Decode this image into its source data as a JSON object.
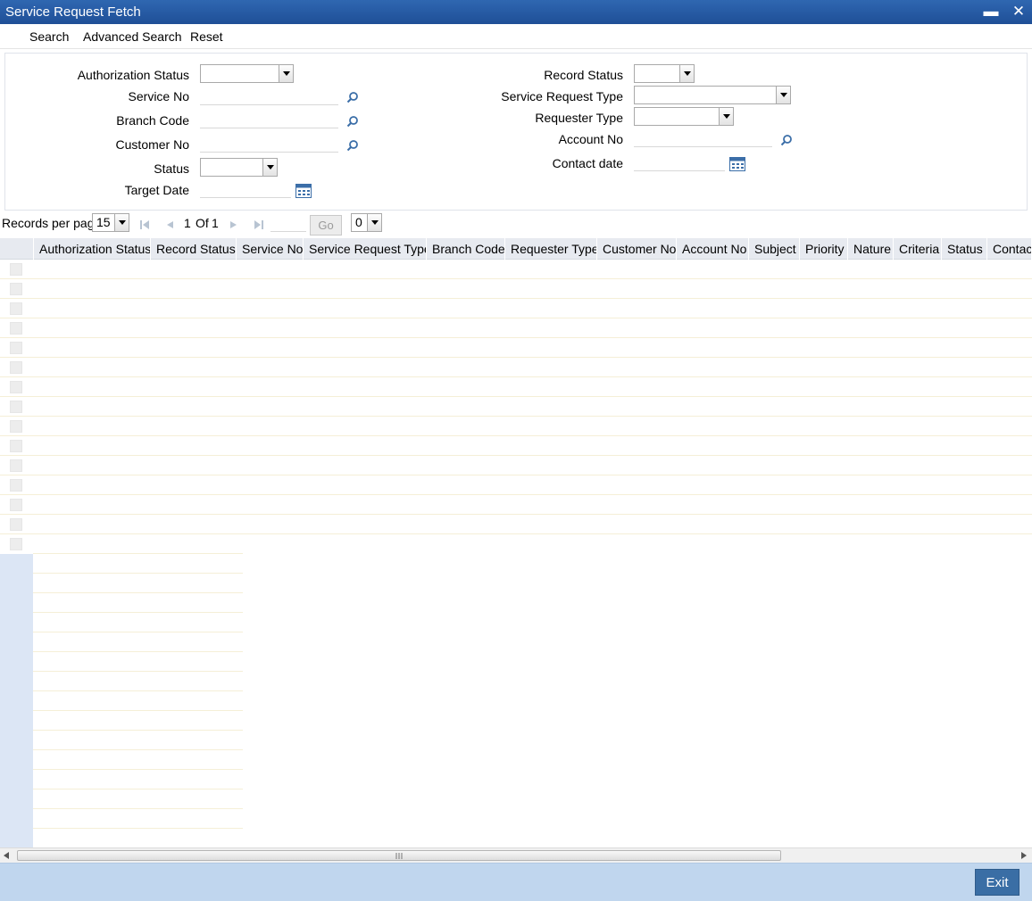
{
  "window": {
    "title": "Service Request Fetch",
    "minimize_glyph": "▬",
    "close_glyph": "✕"
  },
  "menu": {
    "search": "Search",
    "advanced_search": "Advanced Search",
    "reset": "Reset"
  },
  "form": {
    "authorization_status": "Authorization Status",
    "service_no": "Service No",
    "branch_code": "Branch Code",
    "customer_no": "Customer No",
    "status": "Status",
    "target_date": "Target Date",
    "record_status": "Record Status",
    "service_request_type": "Service Request Type",
    "requester_type": "Requester Type",
    "account_no": "Account No",
    "contact_date": "Contact date"
  },
  "pager": {
    "records_per_page": "Records per page",
    "page_size": "15",
    "current_page": "1",
    "of": "Of",
    "total_pages": "1",
    "go": "Go",
    "jump_value": "0"
  },
  "grid": {
    "columns": [
      "Authorization Status",
      "Record Status",
      "Service No",
      "Service Request Type",
      "Branch Code",
      "Requester Type",
      "Customer No",
      "Account No",
      "Subject",
      "Priority",
      "Nature",
      "Criteria",
      "Status",
      "Contact"
    ]
  },
  "footer": {
    "exit": "Exit"
  },
  "colors": {
    "title_bar": "#2f67b1",
    "footer": "#c0d6ee",
    "exit_button": "#3a6ea5"
  }
}
